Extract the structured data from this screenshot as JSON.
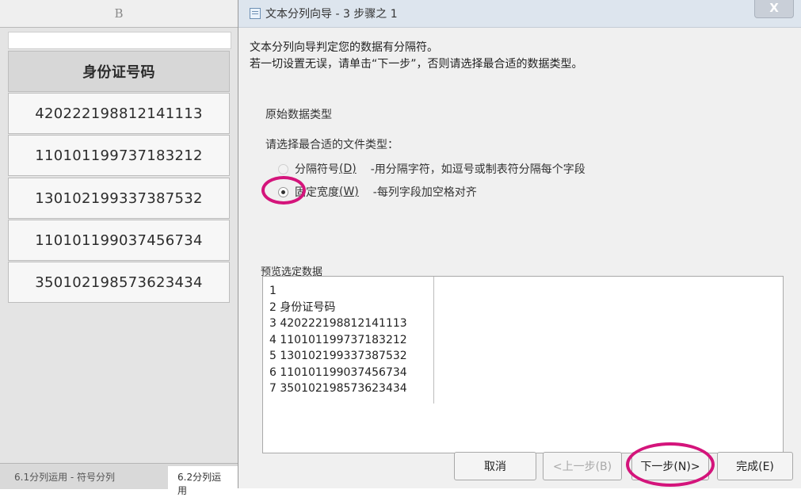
{
  "sheet": {
    "column_header": "B",
    "header_cell": "身份证号码",
    "cells": [
      "420222198812141113",
      "110101199737183212",
      "130102199337387532",
      "110101199037456734",
      "350102198573623434"
    ],
    "tabs": [
      "6.1分列运用 - 符号分列",
      "6.2分列运用"
    ]
  },
  "dialog": {
    "title": "文本分列向导 - 3 步骤之 1",
    "close_label": "X",
    "description_line1": "文本分列向导判定您的数据有分隔符。",
    "description_line2": "若一切设置无误，请单击“下一步”，否则请选择最合适的数据类型。",
    "section_label": "原始数据类型",
    "file_type_label": "请选择最合适的文件类型：",
    "options": [
      {
        "label": "分隔符号",
        "key": "(D)",
        "description": "-用分隔字符，如逗号或制表符分隔每个字段",
        "selected": false
      },
      {
        "label": "固定宽度",
        "key": "(W)",
        "description": "-每列字段加空格对齐",
        "selected": true
      }
    ],
    "preview_label": "预览选定数据",
    "preview_lines": [
      "1",
      "2 身份证号码",
      "3 420222198812141113",
      "4 110101199737183212",
      "5 130102199337387532",
      "6 110101199037456734",
      "7 350102198573623434"
    ],
    "buttons": {
      "cancel": "取消",
      "back": "<上一步(B)",
      "next": "下一步(N)>",
      "finish": "完成(E)"
    }
  },
  "colors": {
    "highlight": "#d4147b",
    "titlebar": "#dde5ee"
  }
}
